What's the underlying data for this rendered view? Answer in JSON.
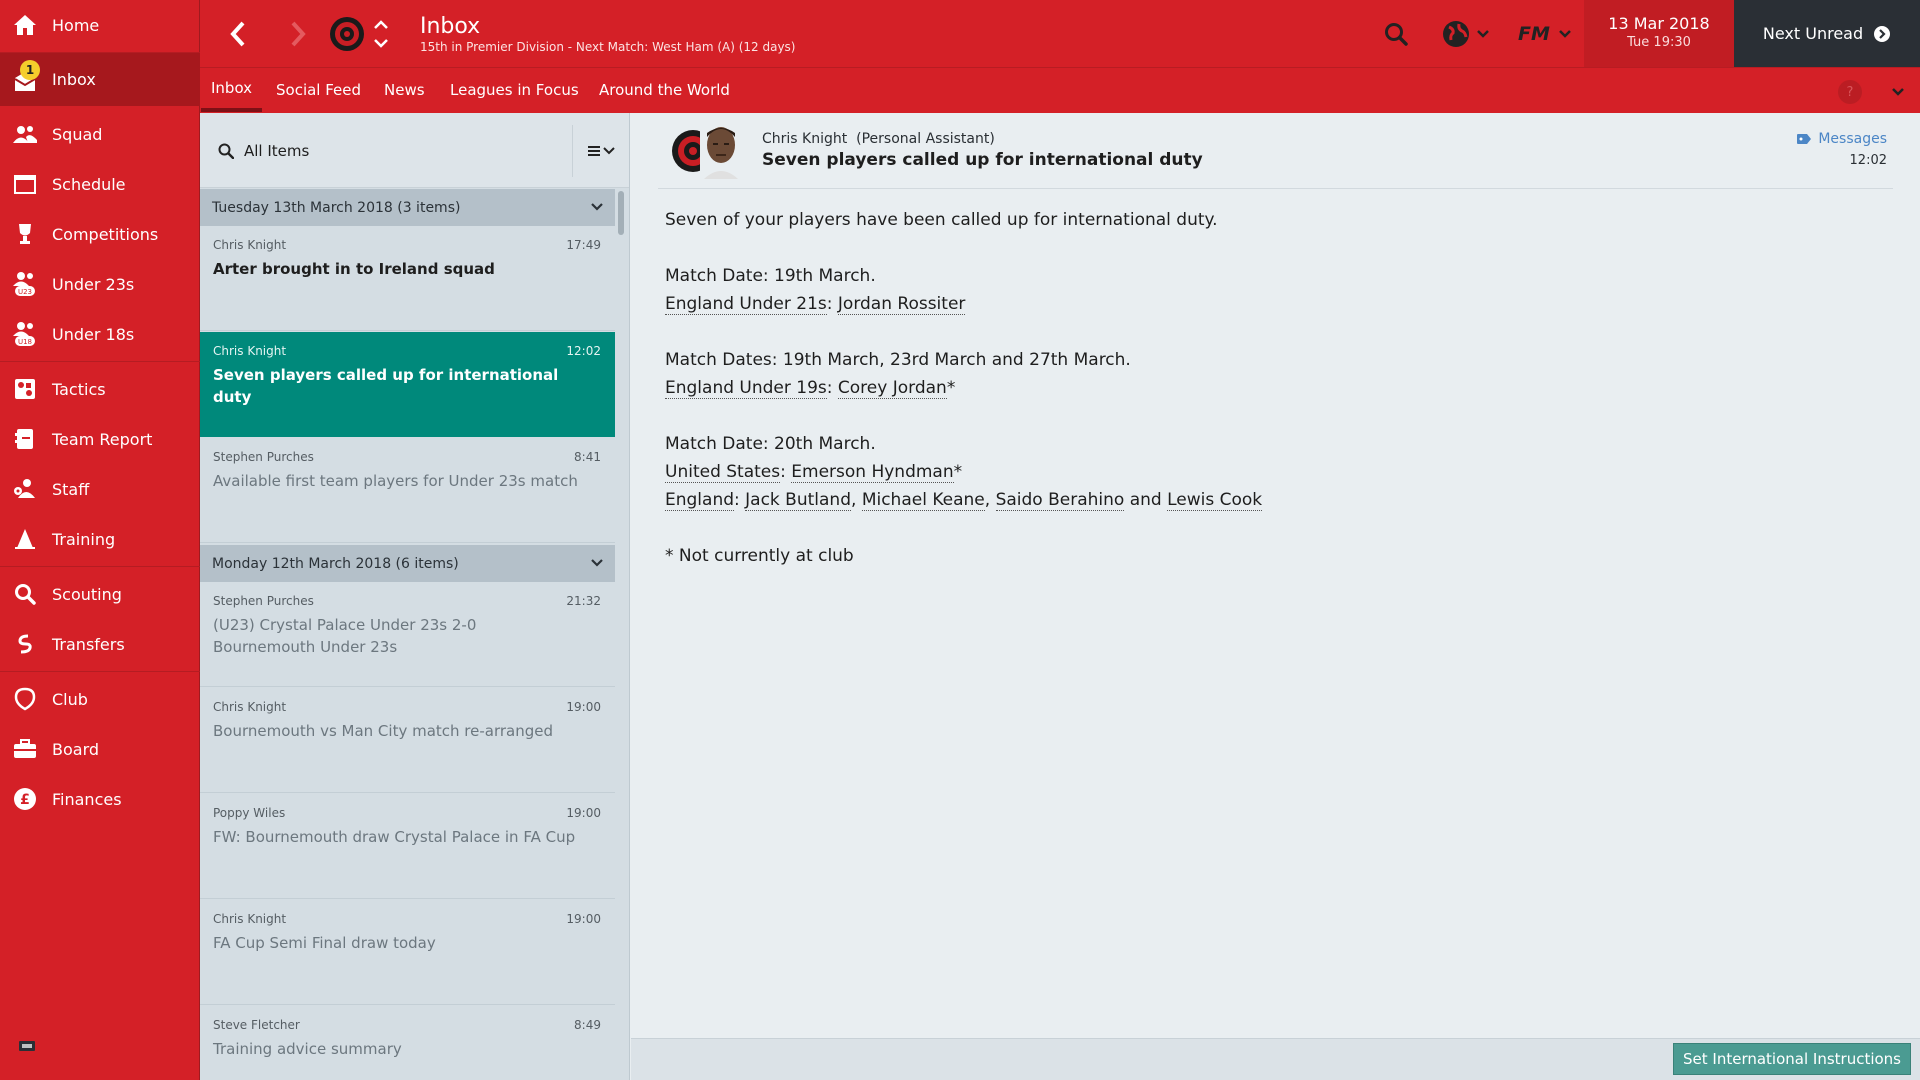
{
  "sidebar": {
    "items": [
      {
        "label": "Home",
        "icon": "home-icon"
      },
      {
        "label": "Inbox",
        "icon": "inbox-icon",
        "badge": "1",
        "active": true
      },
      {
        "label": "Squad",
        "icon": "squad-icon"
      },
      {
        "label": "Schedule",
        "icon": "schedule-icon"
      },
      {
        "label": "Competitions",
        "icon": "trophy-icon"
      },
      {
        "label": "Under 23s",
        "icon": "under23-icon",
        "icon_text": "U23"
      },
      {
        "label": "Under 18s",
        "icon": "under18-icon",
        "icon_text": "U18"
      },
      {
        "label": "Tactics",
        "icon": "tactics-icon"
      },
      {
        "label": "Team Report",
        "icon": "team-report-icon"
      },
      {
        "label": "Staff",
        "icon": "staff-icon"
      },
      {
        "label": "Training",
        "icon": "training-icon"
      },
      {
        "label": "Scouting",
        "icon": "search-icon"
      },
      {
        "label": "Transfers",
        "icon": "transfers-icon"
      },
      {
        "label": "Club",
        "icon": "club-icon"
      },
      {
        "label": "Board",
        "icon": "board-icon"
      },
      {
        "label": "Finances",
        "icon": "finances-icon",
        "icon_text": "£"
      }
    ]
  },
  "header": {
    "title": "Inbox",
    "subtitle": "15th in Premier Division - Next Match: West Ham (A) (12 days)",
    "date": "13 Mar 2018",
    "time": "Tue 19:30",
    "next_unread": "Next Unread",
    "logo_text": "FM"
  },
  "tabs": [
    {
      "label": "Inbox",
      "active": true
    },
    {
      "label": "Social Feed"
    },
    {
      "label": "News"
    },
    {
      "label": "Leagues in Focus"
    },
    {
      "label": "Around the World"
    }
  ],
  "help_label": "?",
  "list": {
    "filter": "All Items",
    "groups": [
      {
        "label": "Tuesday 13th March 2018 (3 items)"
      },
      {
        "label": "Monday 12th March 2018 (6 items)"
      }
    ],
    "messages": [
      {
        "sender": "Chris Knight",
        "time": "17:49",
        "subject": "Arter brought in to Ireland squad"
      },
      {
        "sender": "Chris Knight",
        "time": "12:02",
        "subject": "Seven players called up for international duty"
      },
      {
        "sender": "Stephen Purches",
        "time": "8:41",
        "subject": "Available first team players for Under 23s match"
      },
      {
        "sender": "Stephen Purches",
        "time": "21:32",
        "subject": "(U23) Crystal Palace Under 23s 2-0 Bournemouth Under 23s"
      },
      {
        "sender": "Chris Knight",
        "time": "19:00",
        "subject": "Bournemouth vs Man City match re-arranged"
      },
      {
        "sender": "Poppy Wiles",
        "time": "19:00",
        "subject": "FW: Bournemouth draw Crystal Palace in FA Cup"
      },
      {
        "sender": "Chris Knight",
        "time": "19:00",
        "subject": "FA Cup Semi Final draw today"
      },
      {
        "sender": "Steve Fletcher",
        "time": "8:49",
        "subject": "Training advice summary"
      }
    ]
  },
  "message": {
    "from_name": "Chris Knight",
    "from_role": "(Personal Assistant)",
    "subject": "Seven players called up for international duty",
    "tag": "Messages",
    "time": "12:02",
    "intro": "Seven of your players have been called up for international duty.",
    "match1_date": "Match Date: 19th March.",
    "match1_team": "England Under 21s",
    "match1_player": "Jordan Rossiter",
    "match2_date": "Match Dates: 19th March, 23rd March and 27th March.",
    "match2_team": "England Under 19s",
    "match2_player": "Corey Jordan",
    "match3_date": "Match Date: 20th March.",
    "match3_team1": "United States",
    "match3_player1": "Emerson Hyndman",
    "match3_team2": "England",
    "match3_players2": [
      "Jack Butland",
      "Michael Keane",
      "Saido Berahino",
      "Lewis Cook"
    ],
    "and_word": "and",
    "asterisk": "*",
    "note": "* Not currently at club"
  },
  "actions": {
    "set_international": "Set International Instructions"
  },
  "colors": {
    "brand_red": "#d42027",
    "selected_teal": "#00897b",
    "badge_yellow": "#f5cd2c",
    "next_unread_bg": "#2a2f35"
  }
}
